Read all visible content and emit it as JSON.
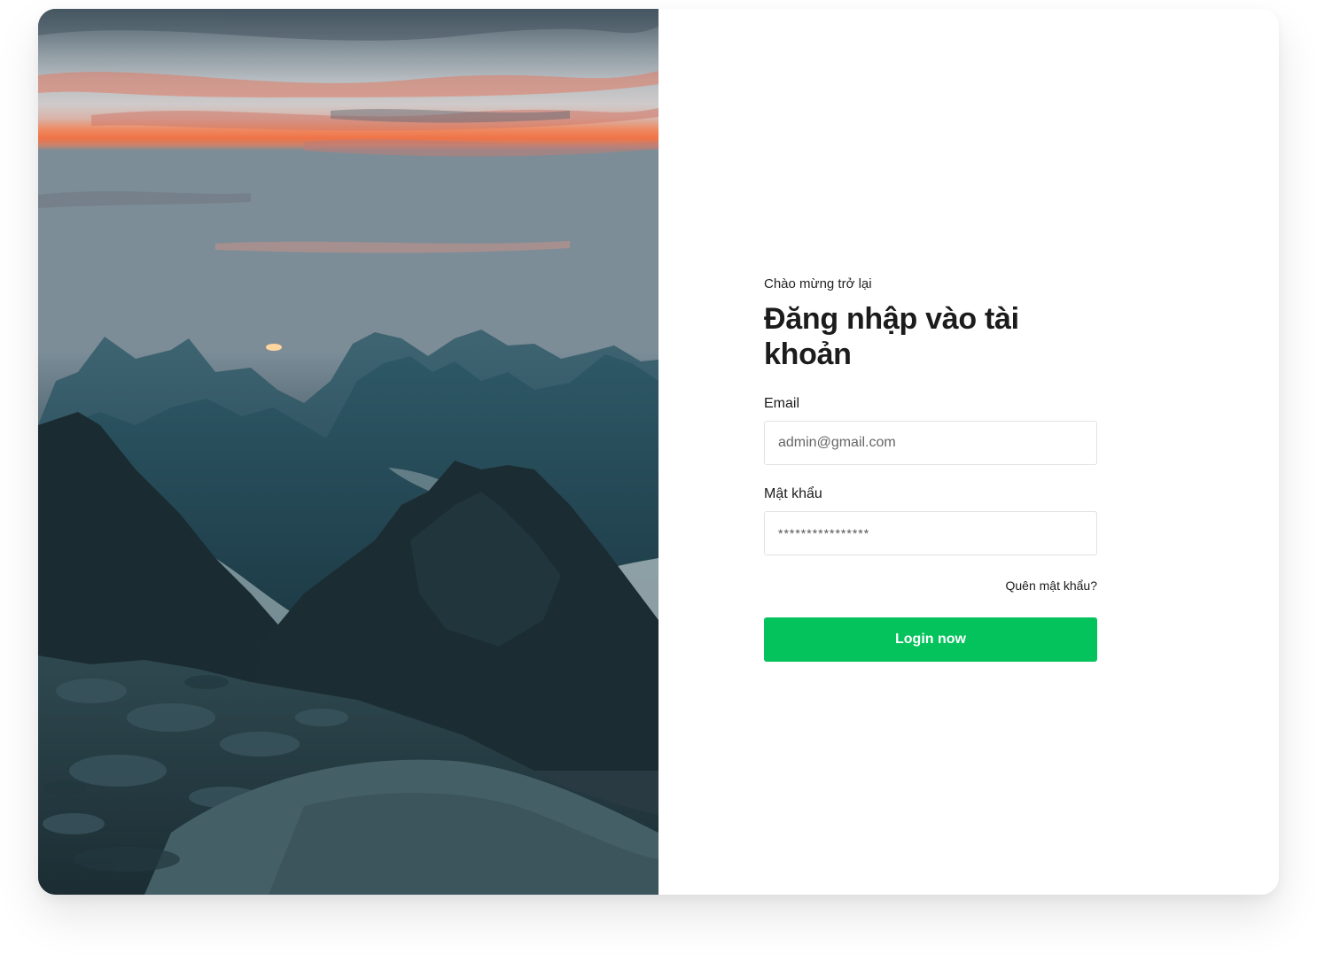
{
  "login": {
    "welcome": "Chào mừng trở lại",
    "title": "Đăng nhập vào tài khoản",
    "email_label": "Email",
    "email_value": "admin@gmail.com",
    "password_label": "Mật khẩu",
    "password_value": "****************",
    "forgot_link": "Quên mật khẩu?",
    "submit_label": "Login now"
  },
  "hero_image": {
    "subject": "mountain-sunset-photo"
  },
  "colors": {
    "accent": "#04c35c",
    "text": "#1c1c1c",
    "input_border": "#e2e2e2"
  }
}
